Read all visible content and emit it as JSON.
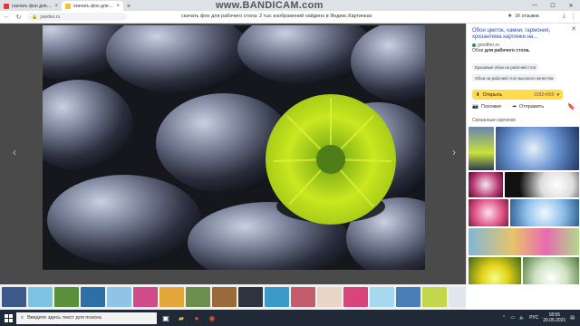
{
  "watermark": "www.BANDICAM.com",
  "tabs": [
    {
      "title": "скачать фон для рабочег",
      "favicon_color": "#e53935",
      "active": false
    },
    {
      "title": "скачать фон для рабочег",
      "favicon_color": "#fbc02d",
      "active": true
    }
  ],
  "address": {
    "url": "yandex.ru",
    "page_title": "скачать фон для рабочего стола: 2 тыс изображений найдено в Яндекс.Картинках",
    "reviews": "1K отзывов"
  },
  "panel": {
    "title": "Обои цветок, камни, гармония, хризантема картинки на...",
    "domain": "goodfon.ru",
    "desc_prefix": "Обои ",
    "desc_bold": "для рабочего стола.",
    "tags": [
      "Красивые обои на рабочий стол",
      "Обои на рабочий стол высокого качества"
    ],
    "open_label": "Открыть",
    "size": "1032×650",
    "similar_label": "Похожие",
    "share_label": "Отправить",
    "related_label": "Связанные картинки"
  },
  "taskbar": {
    "search_placeholder": "Введите здесь текст для поиска",
    "lang": "РУС",
    "time": "18:55",
    "date": "20.05.2021"
  },
  "colors": {
    "accent_yellow": "#ffdb4d",
    "link_blue": "#2c4fb0",
    "viewer_bg": "#4a4a4a",
    "taskbar_bg": "#202a36"
  }
}
